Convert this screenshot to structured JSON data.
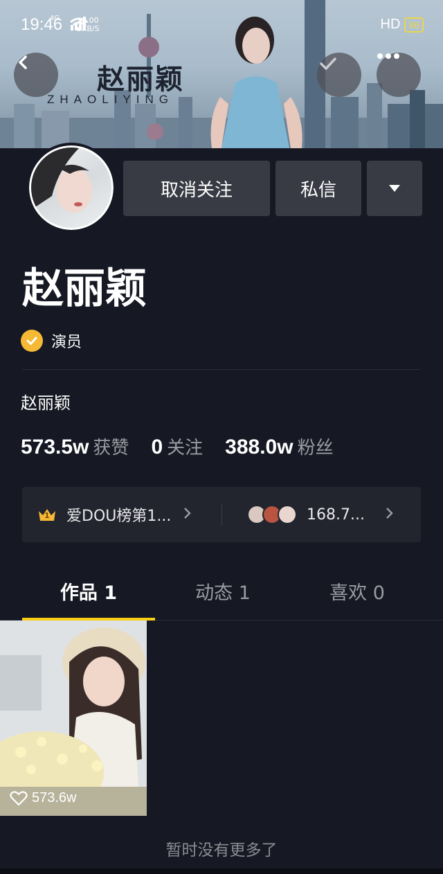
{
  "status_bar": {
    "time": "19:46",
    "network": "4G",
    "speed_value": "0.00",
    "speed_unit": "KB/S",
    "hd_label": "HD",
    "battery": "88"
  },
  "banner": {
    "title_cn": "赵丽颖",
    "title_en": "ZHAOLIYING"
  },
  "header": {
    "back_icon": "chevron-left-icon",
    "check_icon": "check-icon",
    "more_icon": "more-dots-icon"
  },
  "actions": {
    "unfollow_label": "取消关注",
    "message_label": "私信",
    "dropdown_icon": "triangle-down-icon"
  },
  "profile": {
    "name": "赵丽颖",
    "verify_label": "演员",
    "bio": "赵丽颖"
  },
  "stats": [
    {
      "value": "573.5w",
      "label": "获赞"
    },
    {
      "value": "0",
      "label": "关注"
    },
    {
      "value": "388.0w",
      "label": "粉丝"
    }
  ],
  "info_bar": {
    "rank_badge": "1",
    "rank_text": "爱DOU榜第1...",
    "fans_text": "168.7..."
  },
  "tabs": [
    {
      "label": "作品 1",
      "active": true
    },
    {
      "label": "动态 1",
      "active": false
    },
    {
      "label": "喜欢 0",
      "active": false
    }
  ],
  "videos": [
    {
      "likes": "573.6w"
    }
  ],
  "footer": {
    "no_more": "暂时没有更多了"
  },
  "colors": {
    "background": "#161823",
    "accent": "#face15",
    "verify": "#f5b935",
    "button": "#393b44"
  }
}
